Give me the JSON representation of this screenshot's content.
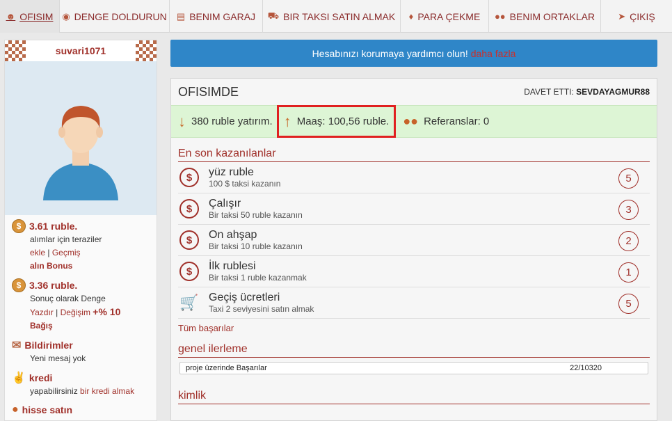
{
  "nav": {
    "items": [
      {
        "label": "OFISIM",
        "icon": "person-icon"
      },
      {
        "label": "DENGE DOLDURUN",
        "icon": "coin-icon"
      },
      {
        "label": "BENIM GARAJ",
        "icon": "id-card-icon"
      },
      {
        "label": "BIR TAKSI SATIN ALMAK",
        "icon": "car-icon"
      },
      {
        "label": "PARA ÇEKME",
        "icon": "money-icon"
      },
      {
        "label": "BENIM ORTAKLAR",
        "icon": "group-icon"
      },
      {
        "label": "ÇIKIŞ",
        "icon": "exit-icon"
      }
    ]
  },
  "sidebar": {
    "username": "suvari1071",
    "balance": {
      "amount": "3.61 ruble.",
      "text": "alımlar için teraziler",
      "link1": "ekle",
      "sep": "|",
      "link2": "Geçmiş",
      "bonus": "alın Bonus"
    },
    "balance2": {
      "amount": "3.36 ruble.",
      "text": "Sonuç olarak Denge",
      "link1": "Yazdır",
      "sep": "|",
      "link2": "Değişim",
      "percent": "+% 10",
      "bonus": "Bağış"
    },
    "notifications": {
      "title": "Bildirimler",
      "text": "Yeni mesaj yok"
    },
    "credit": {
      "title": "kredi",
      "text": "yapabilirsiniz",
      "link": "bir kredi almak"
    },
    "shares": {
      "title": "hisse satın"
    }
  },
  "banner": {
    "text": "Hesabınızı korumaya yardımcı olun!",
    "link": "daha fazla"
  },
  "panel": {
    "title": "OFISIMDE",
    "invited_label": "DAVET ETTI:",
    "invited_by": "SEVDAYAGMUR88",
    "stats": {
      "investment": "380 ruble yatırım.",
      "salary": "Maaş: 100,56 ruble.",
      "referrals": "Referanslar: 0"
    },
    "achievements_title": "En son kazanılanlar",
    "achievements": [
      {
        "name": "yüz ruble",
        "desc": "100 $ taksi kazanın",
        "count": "5",
        "icon": "dollar-coin-icon"
      },
      {
        "name": "Çalışır",
        "desc": "Bir taksi 50 ruble kazanın",
        "count": "3",
        "icon": "dollar-coin-icon"
      },
      {
        "name": "On ahşap",
        "desc": "Bir taksi 10 ruble kazanın",
        "count": "2",
        "icon": "dollar-coin-icon"
      },
      {
        "name": "İlk rublesi",
        "desc": "Bir taksi 1 ruble kazanmak",
        "count": "1",
        "icon": "dollar-coin-icon"
      },
      {
        "name": "Geçiş ücretleri",
        "desc": "Taxi 2 seviyesini satın almak",
        "count": "5",
        "icon": "cart-icon"
      }
    ],
    "all_achievements": "Tüm başarılar",
    "progress_title": "genel ilerleme",
    "progress": {
      "label": "proje üzerinde Başarılar",
      "value": "22/10320"
    },
    "identity_title": "kimlik"
  }
}
